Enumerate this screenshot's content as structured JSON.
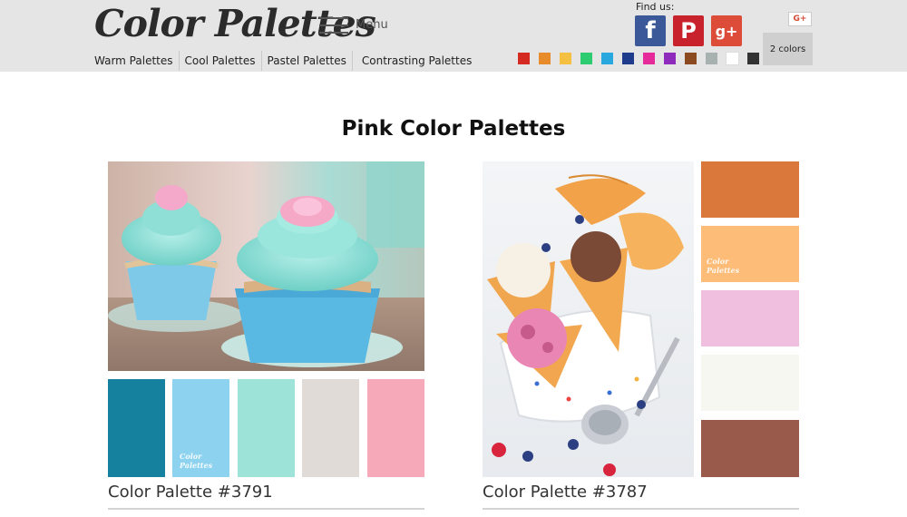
{
  "header": {
    "logo": "Color Palettes",
    "menu_label": "Menu",
    "nav": [
      "Warm Palettes",
      "Cool Palettes",
      "Pastel Palettes",
      "Contrasting Palettes"
    ],
    "find_us": "Find us:",
    "social": {
      "facebook": "f",
      "pinterest": "P",
      "googleplus": "g+",
      "gplus_badge": "G+"
    },
    "two_colors": "2 colors",
    "swatch_colors": [
      "#d42a22",
      "#e88c2b",
      "#f5c042",
      "#2ecc71",
      "#29a8e0",
      "#1f3b8c",
      "#e62a9a",
      "#8e2bbd",
      "#8b4a1f",
      "#a7b1b0",
      "#ffffff",
      "#333333"
    ]
  },
  "main": {
    "title": "Pink Color Palettes",
    "palettes": [
      {
        "caption": "Color Palette #3791",
        "colors": [
          "#16809f",
          "#8dd3ef",
          "#9ee3d8",
          "#e1dbd8",
          "#f6a9b8"
        ],
        "watermark": "Color Palettes"
      },
      {
        "caption": "Color Palette #3787",
        "colors": [
          "#d9783a",
          "#fdbc77",
          "#f0bfe0",
          "#f7f7f1",
          "#9a5a4b"
        ],
        "watermark": "Color Palettes"
      }
    ]
  }
}
